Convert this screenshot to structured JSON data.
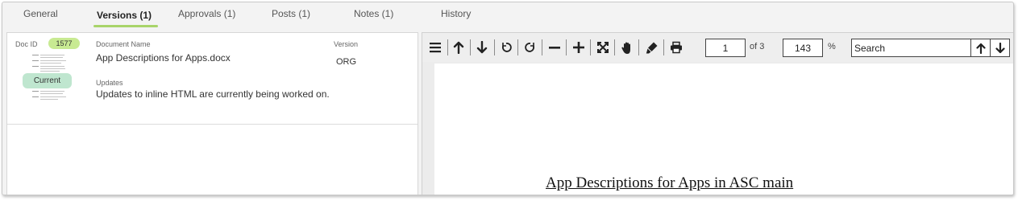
{
  "tabs": [
    {
      "label": "General"
    },
    {
      "label": "Versions (1)",
      "active": true
    },
    {
      "label": "Approvals (1)"
    },
    {
      "label": "Posts (1)"
    },
    {
      "label": "Notes (1)"
    },
    {
      "label": "History"
    }
  ],
  "version_card": {
    "doc_id_label": "Doc ID",
    "doc_id": "1577",
    "current_label": "Current",
    "document_name_label": "Document Name",
    "document_name": "App Descriptions for Apps.docx",
    "version_label": "Version",
    "version": "ORG",
    "updates_label": "Updates",
    "updates": "Updates to inline HTML are currently being worked on."
  },
  "viewer": {
    "page_number": "1",
    "page_total": "of 3",
    "zoom": "143",
    "zoom_unit": "%",
    "search_value": "Search",
    "document_heading": "App Descriptions for Apps in ASC main"
  },
  "colors": {
    "tab_underline": "#a8d46a",
    "doc_id_badge": "#c8ea92",
    "current_badge": "#bfe6cf"
  }
}
